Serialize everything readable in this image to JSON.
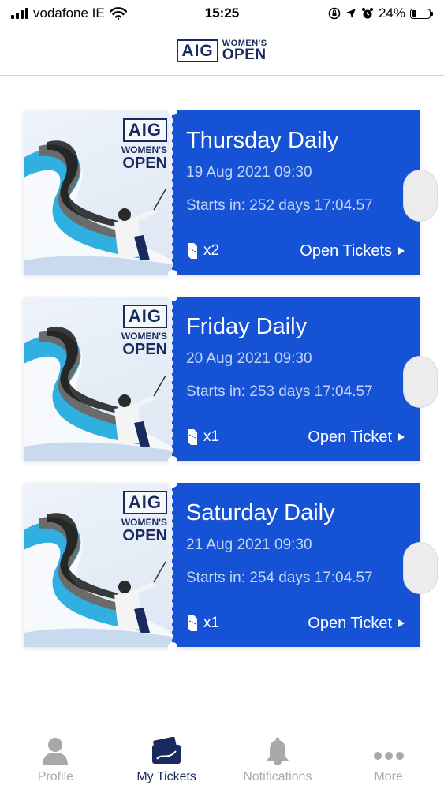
{
  "status_bar": {
    "carrier": "vodafone IE",
    "time": "15:25",
    "battery_percent": "24%",
    "battery_level": 0.24
  },
  "header": {
    "logo_box": "AIG",
    "logo_line1": "WOMEN'S",
    "logo_line2": "OPEN"
  },
  "tickets": [
    {
      "title": "Thursday Daily",
      "date": "19 Aug 2021  09:30",
      "starts": "Starts in: 252 days 17:04.57",
      "qty": "x2",
      "action": "Open Tickets"
    },
    {
      "title": "Friday Daily",
      "date": "20 Aug 2021  09:30",
      "starts": "Starts in: 253 days 17:04.57",
      "qty": "x1",
      "action": "Open Ticket"
    },
    {
      "title": "Saturday Daily",
      "date": "21 Aug 2021  09:30",
      "starts": "Starts in: 254 days 17:04.57",
      "qty": "x1",
      "action": "Open Ticket"
    }
  ],
  "tab_bar": {
    "items": [
      {
        "label": "Profile",
        "icon": "person-icon"
      },
      {
        "label": "My Tickets",
        "icon": "tickets-icon"
      },
      {
        "label": "Notifications",
        "icon": "bell-icon"
      },
      {
        "label": "More",
        "icon": "more-dots-icon"
      }
    ],
    "active": "My Tickets"
  },
  "colors": {
    "ticket_blue": "#1552d6",
    "brand_navy": "#1a2a5e",
    "inactive_gray": "#a9a9a9"
  }
}
